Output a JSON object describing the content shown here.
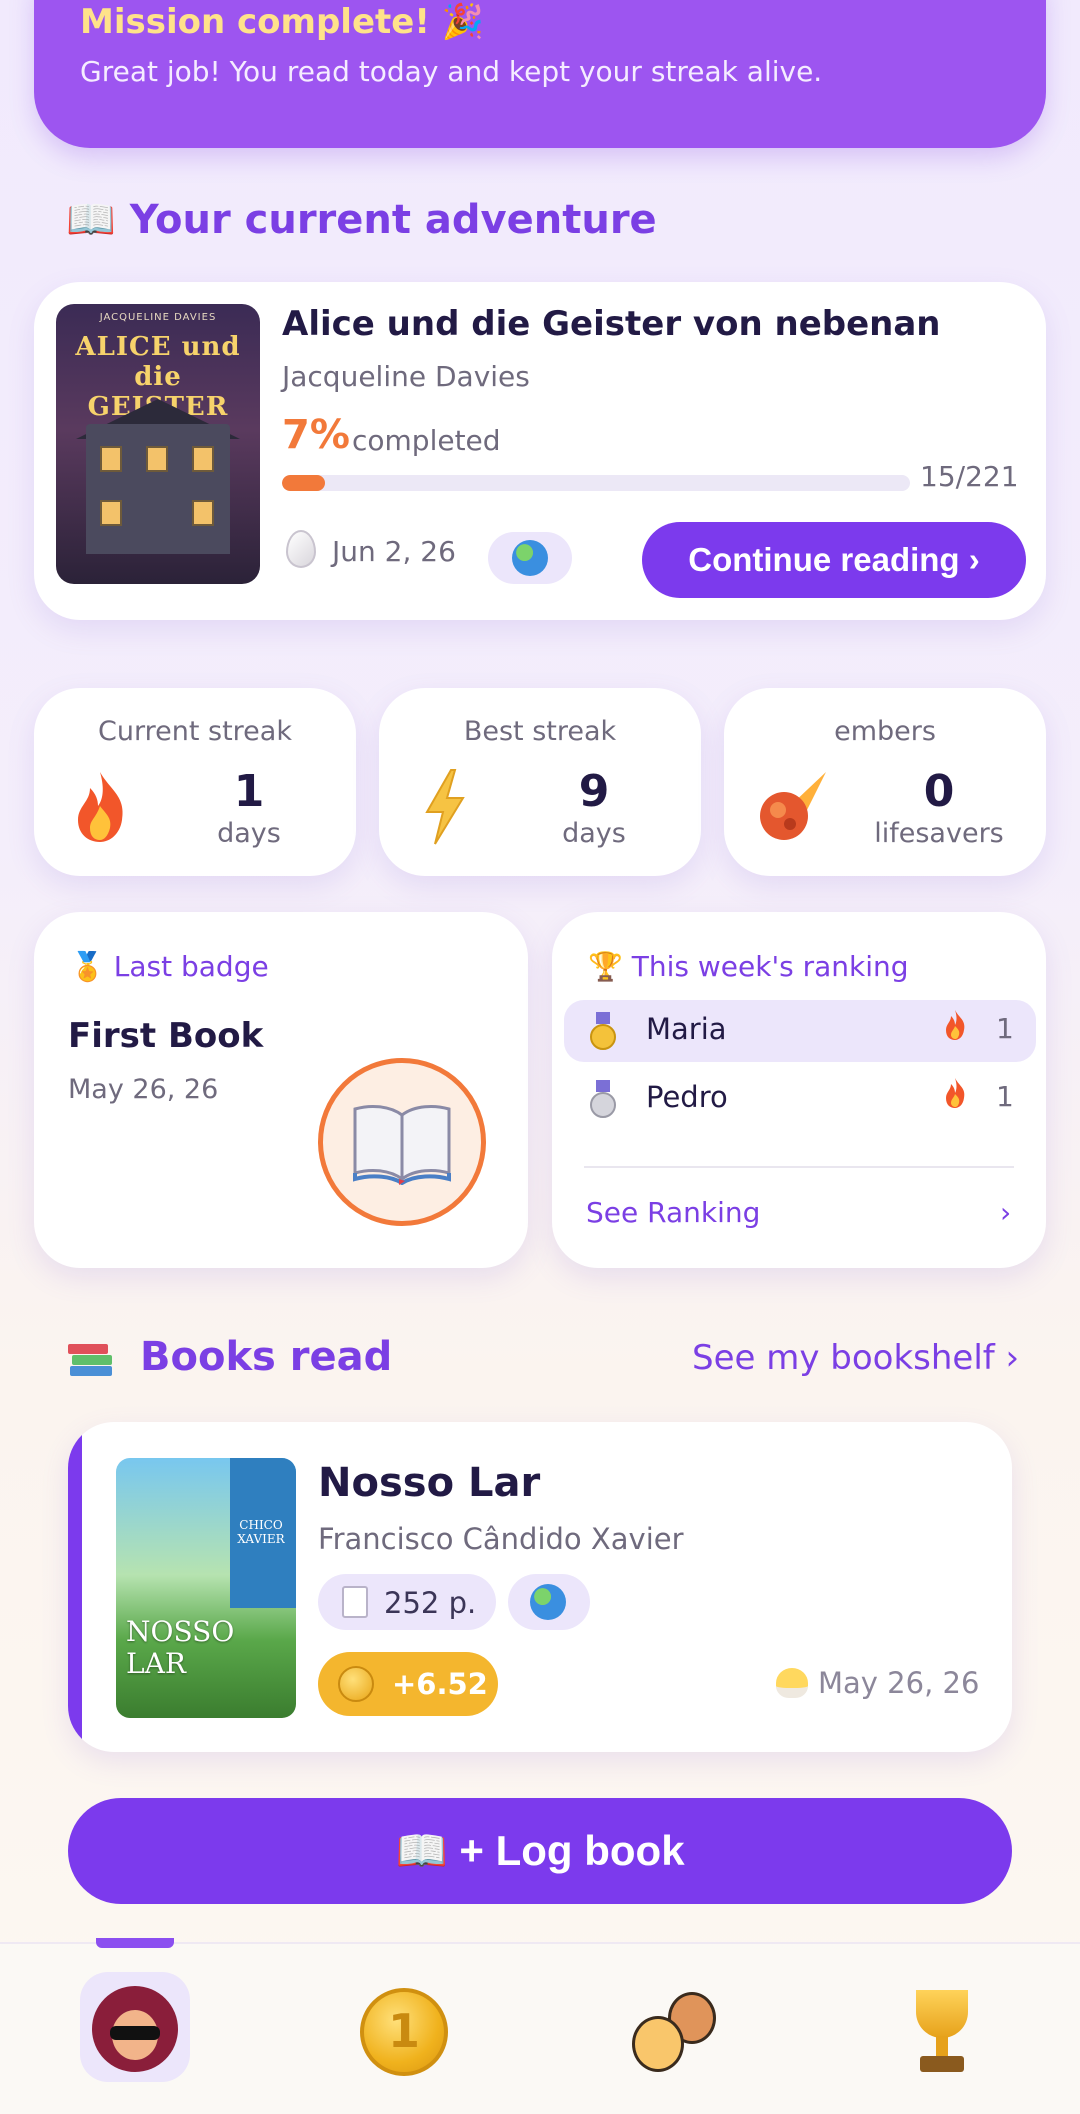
{
  "mission": {
    "title": "Mission complete! 🎉",
    "message": "Great job! You read today and kept your streak alive."
  },
  "current_adventure": {
    "section_title": "📖 Your current adventure",
    "cover_title": "ALICE und die GEISTER von nebenan",
    "cover_author": "JACQUELINE DAVIES",
    "title": "Alice und die Geister von nebenan",
    "author": "Jacqueline Davies",
    "percent": "7%",
    "percent_label": "completed",
    "progress_fraction": 0.0679,
    "progress_count": "15/221",
    "date": "Jun 2, 26",
    "continue_label": "Continue reading ›"
  },
  "stats": [
    {
      "label": "Current streak",
      "value": "1",
      "unit": "days",
      "icon": "fire-icon"
    },
    {
      "label": "Best streak",
      "value": "9",
      "unit": "days",
      "icon": "lightning-icon"
    },
    {
      "label": "embers",
      "value": "0",
      "unit": "lifesavers",
      "icon": "comet-icon"
    }
  ],
  "last_badge": {
    "heading": "🏅 Last badge",
    "name": "First Book",
    "date": "May 26, 26"
  },
  "ranking": {
    "heading": "🏆 This week's ranking",
    "rows": [
      {
        "name": "Maria",
        "score": "1",
        "medal": "gold"
      },
      {
        "name": "Pedro",
        "score": "1",
        "medal": "silver"
      }
    ],
    "see_label": "See Ranking",
    "see_chevron": "›"
  },
  "books_read": {
    "section_title": "Books read",
    "see_bookshelf": "See my bookshelf ›",
    "book": {
      "cover_title": "NOSSO LAR",
      "cover_author": "CHICO XAVIER",
      "title": "Nosso Lar",
      "author": "Francisco Cândido Xavier",
      "pages": "252 p.",
      "coins": "+6.52",
      "date": "May 26, 26"
    }
  },
  "log_book_label": "📖 + Log book",
  "nav": {
    "items": [
      "profile",
      "coins",
      "friends",
      "trophies"
    ],
    "coin_number": "1",
    "active": "profile"
  },
  "colors": {
    "primary": "#7c3aed",
    "accent_orange": "#f2793a",
    "banner": "#9d55f0",
    "coin_gold": "#f4b62e"
  }
}
